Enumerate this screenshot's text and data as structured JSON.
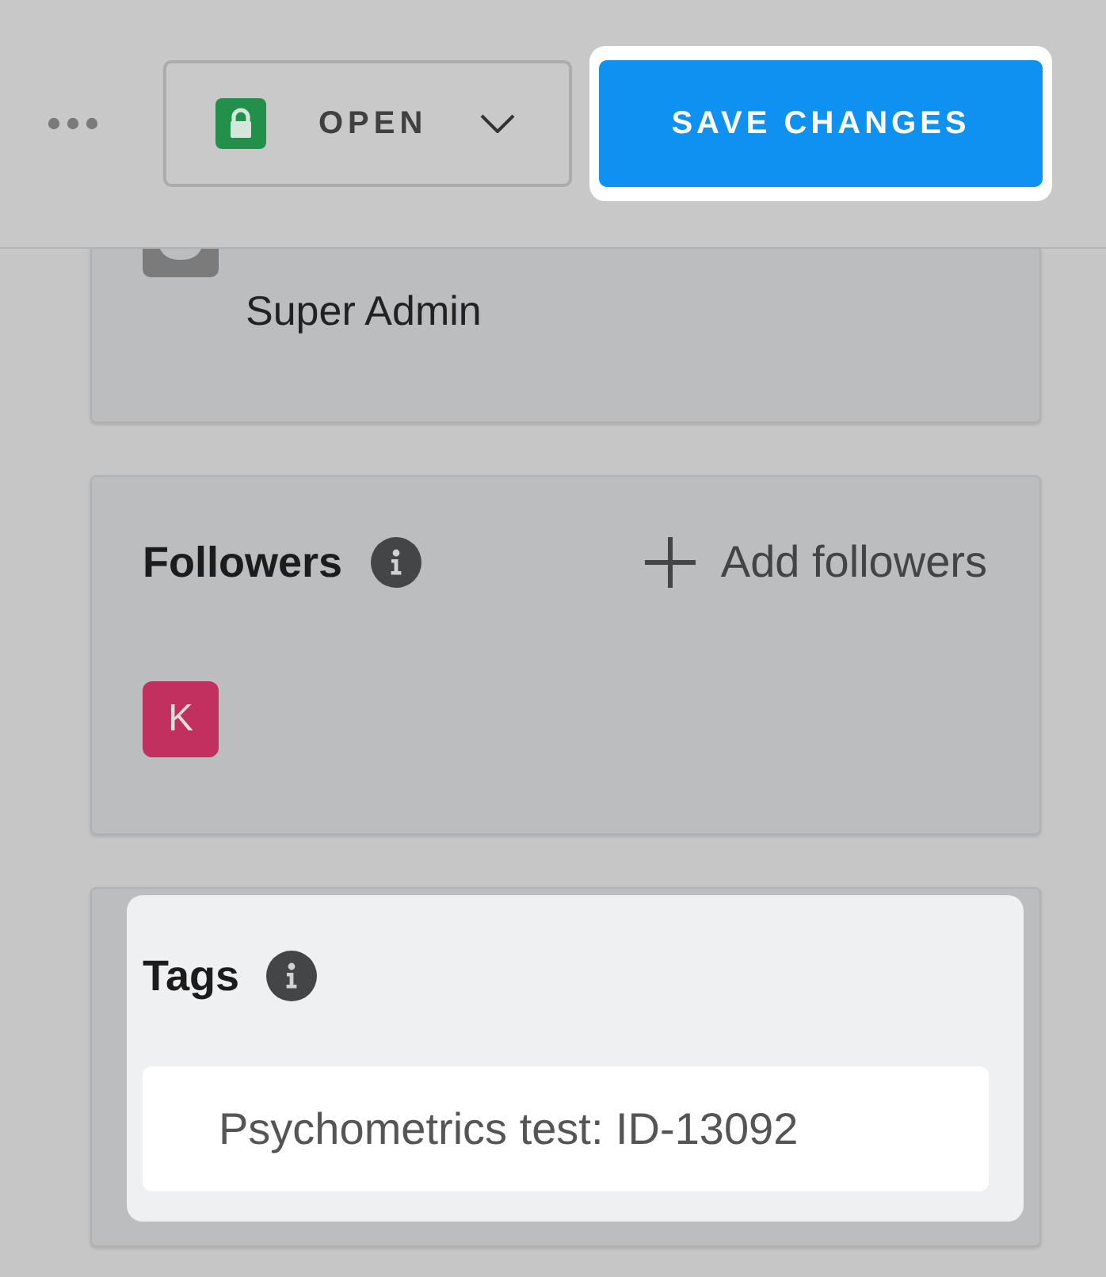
{
  "header": {
    "status_dropdown": {
      "label": "OPEN"
    },
    "save_button": {
      "label": "SAVE CHANGES",
      "highlighted": true
    }
  },
  "access_card": {
    "role": "Super Admin"
  },
  "followers": {
    "title": "Followers",
    "add_label": "Add followers",
    "avatars": [
      {
        "initial": "K",
        "color": "#c2305f"
      }
    ]
  },
  "tags": {
    "title": "Tags",
    "highlighted": true,
    "field": {
      "value": "Psychometrics test: ID-13092"
    }
  }
}
